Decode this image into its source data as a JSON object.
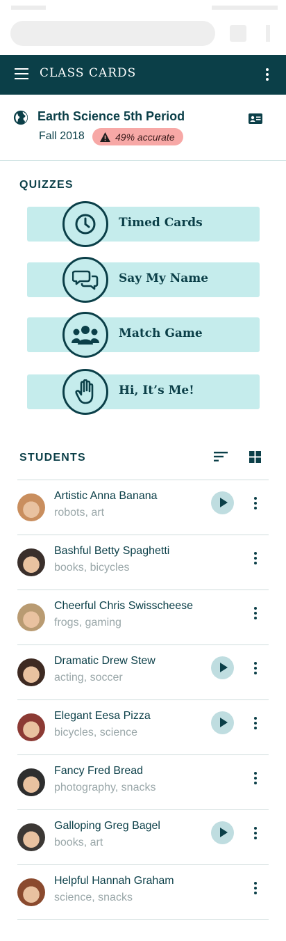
{
  "app": {
    "title": "CLASS CARDS",
    "colors": {
      "primary": "#0b3f48",
      "quiz_bg": "#c5ecec",
      "alert_badge": "#f7a8a6",
      "play_bg": "#bfdde0"
    }
  },
  "class_info": {
    "name": "Earth Science 5th Period",
    "term": "Fall 2018",
    "accuracy_badge": "49% accurate",
    "icon": "globe-icon"
  },
  "quizzes": {
    "heading": "QUIZZES",
    "items": [
      {
        "label": "Timed Cards",
        "icon": "clock-icon"
      },
      {
        "label": "Say My Name",
        "icon": "chat-bubbles-icon"
      },
      {
        "label": "Match Game",
        "icon": "group-icon"
      },
      {
        "label": "Hi, It’s Me!",
        "icon": "hand-icon"
      }
    ]
  },
  "students": {
    "heading": "STUDENTS",
    "items": [
      {
        "name": "Artistic Anna Banana",
        "tags": "robots, art",
        "has_audio": true,
        "avatar_color": "#c98e5e"
      },
      {
        "name": "Bashful Betty Spaghetti",
        "tags": "books, bicycles",
        "has_audio": false,
        "avatar_color": "#3a2f2b"
      },
      {
        "name": "Cheerful Chris Swisscheese",
        "tags": "frogs, gaming",
        "has_audio": false,
        "avatar_color": "#b99b72"
      },
      {
        "name": "Dramatic Drew Stew",
        "tags": "acting, soccer",
        "has_audio": true,
        "avatar_color": "#3e2a22"
      },
      {
        "name": "Elegant Eesa Pizza",
        "tags": "bicycles, science",
        "has_audio": true,
        "avatar_color": "#8c3a34"
      },
      {
        "name": "Fancy Fred Bread",
        "tags": "photography, snacks",
        "has_audio": false,
        "avatar_color": "#2e2e2e"
      },
      {
        "name": "Galloping Greg Bagel",
        "tags": "books, art",
        "has_audio": true,
        "avatar_color": "#3c3835"
      },
      {
        "name": "Helpful Hannah Graham",
        "tags": "science, snacks",
        "has_audio": false,
        "avatar_color": "#8a4a2e"
      }
    ]
  }
}
